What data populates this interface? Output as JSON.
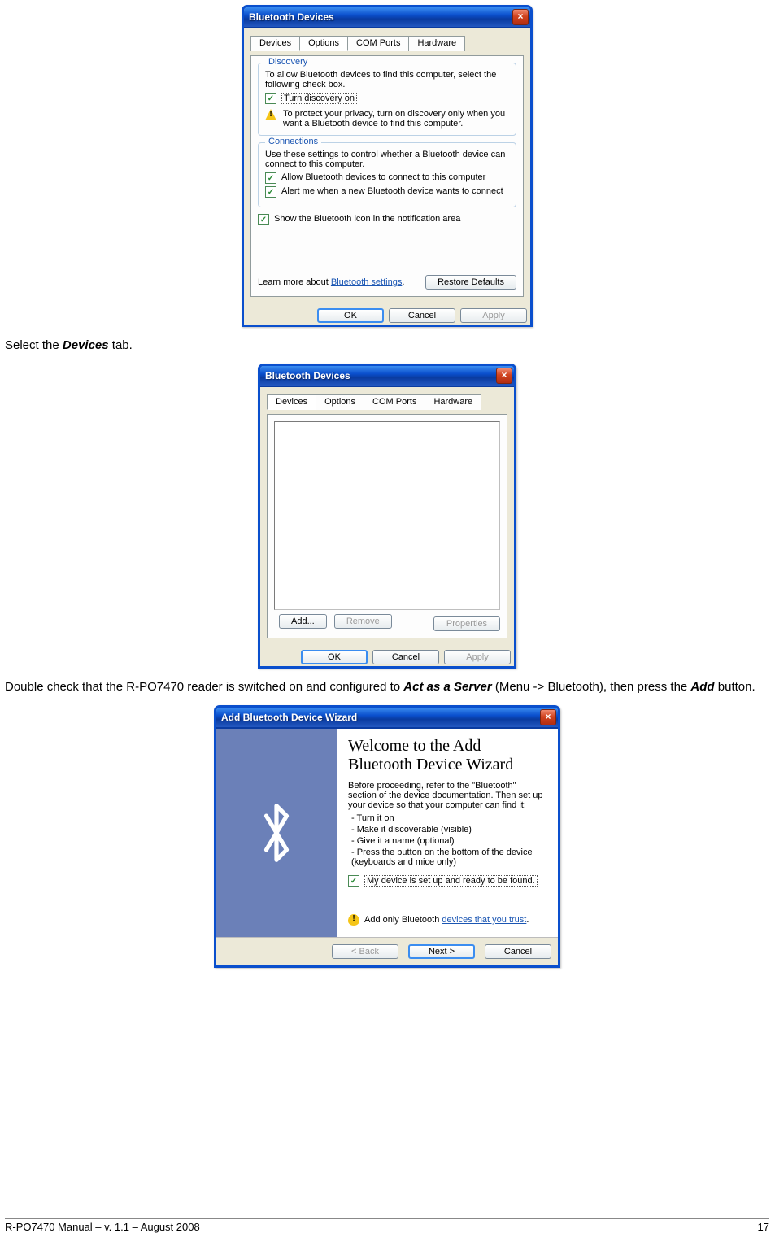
{
  "win1": {
    "title": "Bluetooth Devices",
    "tabs": [
      "Devices",
      "Options",
      "COM Ports",
      "Hardware"
    ],
    "activeTab": 1,
    "discovery": {
      "legend": "Discovery",
      "intro": "To allow Bluetooth devices to find this computer, select the following check box.",
      "chk": "Turn discovery on",
      "warn": "To protect your privacy, turn on discovery only when you want a Bluetooth device to find this computer."
    },
    "connections": {
      "legend": "Connections",
      "intro": "Use these settings to control whether a Bluetooth device can connect to this computer.",
      "chk1": "Allow Bluetooth devices to connect to this computer",
      "chk2": "Alert me when a new Bluetooth device wants to connect"
    },
    "showIcon": "Show the Bluetooth icon in the notification area",
    "learnPrefix": "Learn more about ",
    "learnLink": "Bluetooth settings",
    "restore": "Restore Defaults",
    "ok": "OK",
    "cancel": "Cancel",
    "apply": "Apply"
  },
  "doc": {
    "p1a": "Select the ",
    "p1b": "Devices",
    "p1c": " tab.",
    "p2a": "Double check that the R-PO7470 reader is switched on and configured to ",
    "p2b": "Act as a Server",
    "p2c": " (Menu -> Bluetooth), then press the ",
    "p2d": "Add",
    "p2e": " button.",
    "footerLeft": "R-PO7470 Manual – v. 1.1 – August 2008",
    "footerRight": "17"
  },
  "win2": {
    "title": "Bluetooth Devices",
    "tabs": [
      "Devices",
      "Options",
      "COM Ports",
      "Hardware"
    ],
    "activeTab": 0,
    "add": "Add...",
    "remove": "Remove",
    "properties": "Properties",
    "ok": "OK",
    "cancel": "Cancel",
    "apply": "Apply"
  },
  "win3": {
    "title": "Add Bluetooth Device Wizard",
    "heading": "Welcome to the Add Bluetooth Device Wizard",
    "intro": "Before proceeding, refer to the \"Bluetooth\" section of the device documentation. Then set up your device so that your computer can find it:",
    "steps": [
      "Turn it on",
      "Make it discoverable (visible)",
      "Give it a name (optional)",
      "Press the button on the bottom of the device (keyboards and mice only)"
    ],
    "chk": "My device is set up and ready to be found.",
    "trustPrefix": "Add only Bluetooth ",
    "trustLink": "devices that you trust",
    "back": "< Back",
    "next": "Next >",
    "cancel": "Cancel"
  }
}
